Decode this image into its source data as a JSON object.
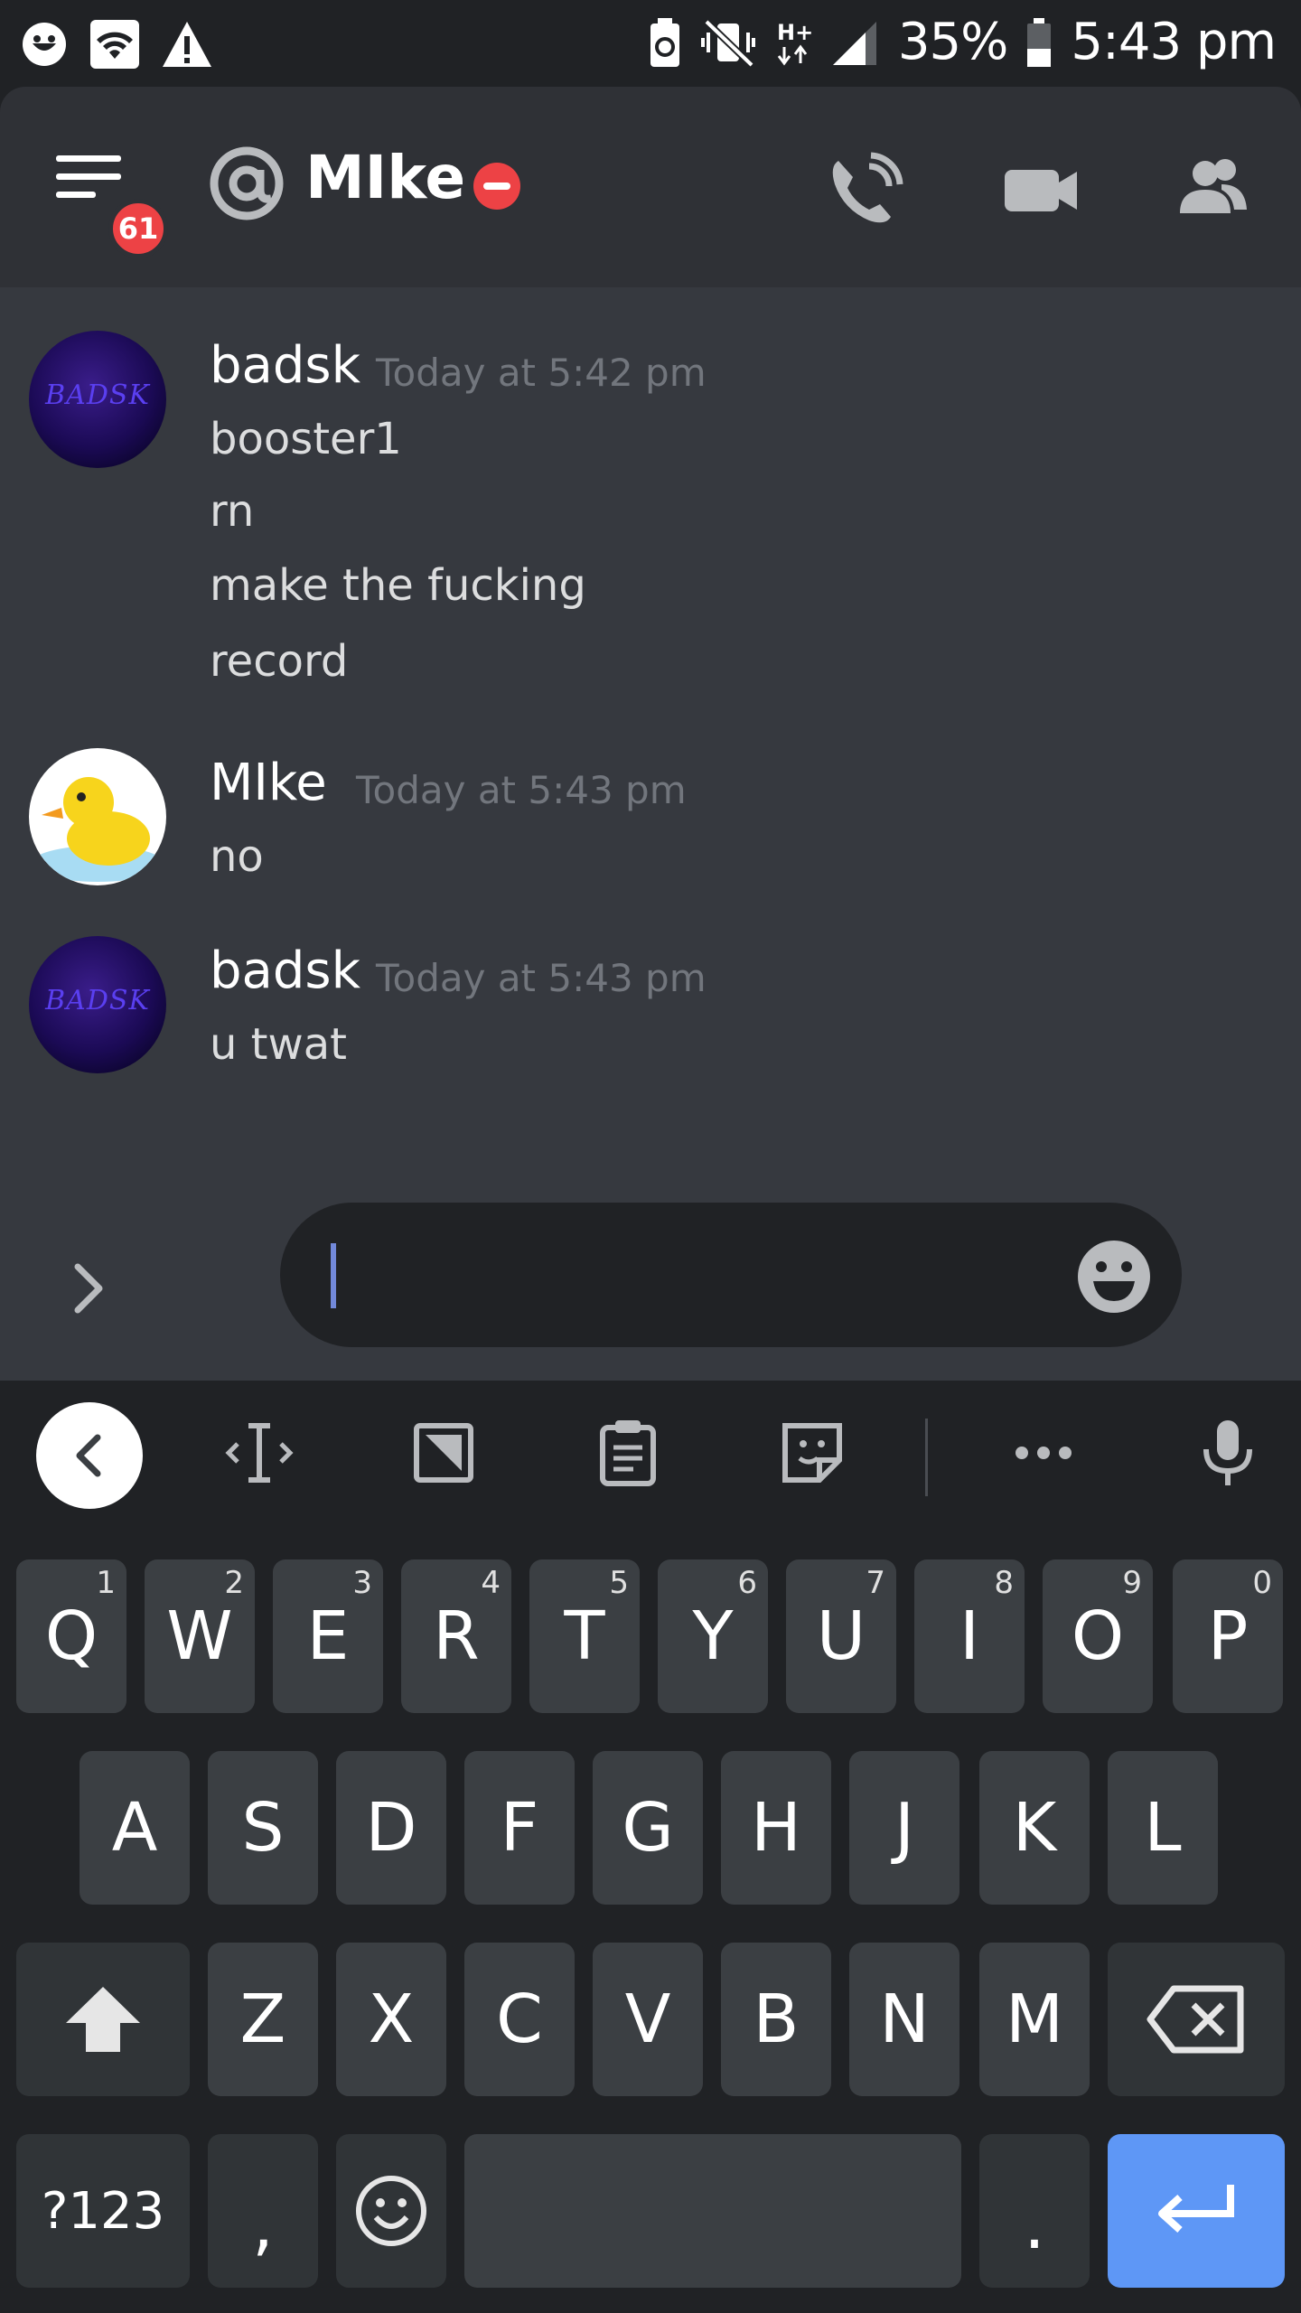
{
  "status_bar": {
    "battery_pct": "35%",
    "time": "5:43 pm",
    "network": "H+"
  },
  "header": {
    "channel_name": "MIke",
    "notification_count": "61"
  },
  "messages": [
    {
      "author": "badsk",
      "timestamp": "Today at 5:42 pm",
      "avatar_text": "BADSK",
      "lines": [
        "booster1",
        "rn",
        "make the fucking",
        "record"
      ]
    },
    {
      "author": "MIke",
      "timestamp": "Today at 5:43 pm",
      "lines": [
        "no"
      ]
    },
    {
      "author": "badsk",
      "timestamp": "Today at 5:43 pm",
      "avatar_text": "BADSK",
      "lines": [
        "u twat"
      ]
    }
  ],
  "composer": {
    "placeholder": ""
  },
  "keyboard": {
    "row1": [
      {
        "label": "Q",
        "hint": "1"
      },
      {
        "label": "W",
        "hint": "2"
      },
      {
        "label": "E",
        "hint": "3"
      },
      {
        "label": "R",
        "hint": "4"
      },
      {
        "label": "T",
        "hint": "5"
      },
      {
        "label": "Y",
        "hint": "6"
      },
      {
        "label": "U",
        "hint": "7"
      },
      {
        "label": "I",
        "hint": "8"
      },
      {
        "label": "O",
        "hint": "9"
      },
      {
        "label": "P",
        "hint": "0"
      }
    ],
    "row2": [
      "A",
      "S",
      "D",
      "F",
      "G",
      "H",
      "J",
      "K",
      "L"
    ],
    "row3": [
      "Z",
      "X",
      "C",
      "V",
      "B",
      "N",
      "M"
    ],
    "symbols_label": "?123",
    "comma_label": ",",
    "period_label": "."
  },
  "colors": {
    "background": "#36393f",
    "header": "#2f3136",
    "badge": "#ed4245",
    "enter_key": "#5e97f6"
  }
}
